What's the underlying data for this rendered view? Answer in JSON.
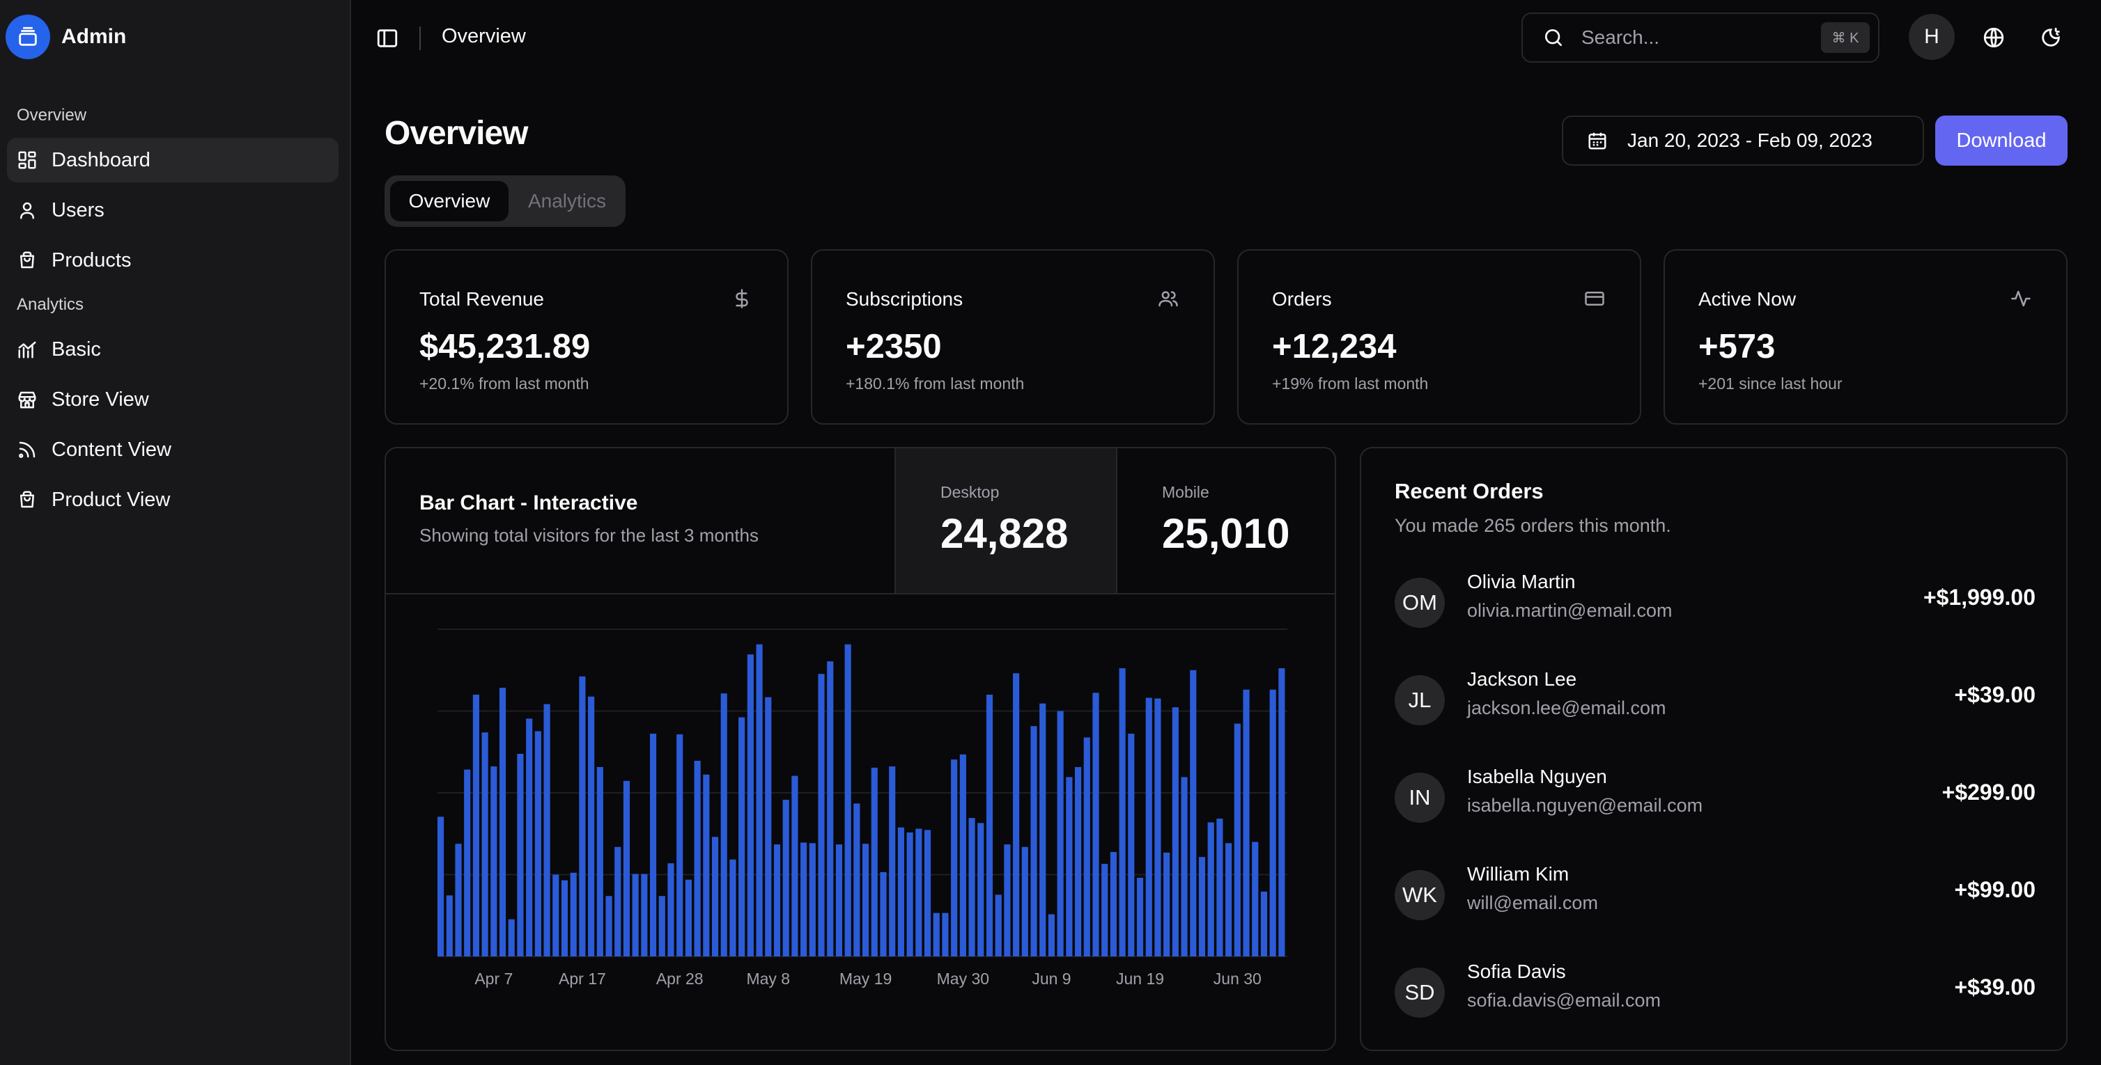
{
  "brand": {
    "name": "Admin"
  },
  "sidebar": {
    "sections": [
      {
        "label": "Overview",
        "items": [
          {
            "label": "Dashboard",
            "icon": "dashboard-icon",
            "active": true
          },
          {
            "label": "Users",
            "icon": "user-icon"
          },
          {
            "label": "Products",
            "icon": "shopping-bag-icon"
          }
        ]
      },
      {
        "label": "Analytics",
        "items": [
          {
            "label": "Basic",
            "icon": "chart-line-icon"
          },
          {
            "label": "Store View",
            "icon": "store-icon"
          },
          {
            "label": "Content View",
            "icon": "rss-icon"
          },
          {
            "label": "Product View",
            "icon": "shopping-bag-icon"
          }
        ]
      }
    ]
  },
  "header": {
    "title": "Overview",
    "search_placeholder": "Search...",
    "search_shortcut": "⌘ K",
    "avatar_initial": "H"
  },
  "main": {
    "title": "Overview",
    "date_range": "Jan 20, 2023 - Feb 09, 2023",
    "download_label": "Download",
    "tabs": [
      {
        "label": "Overview",
        "active": true
      },
      {
        "label": "Analytics"
      }
    ]
  },
  "stats": [
    {
      "label": "Total Revenue",
      "value": "$45,231.89",
      "sub": "+20.1% from last month",
      "icon": "dollar-icon"
    },
    {
      "label": "Subscriptions",
      "value": "+2350",
      "sub": "+180.1% from last month",
      "icon": "users-icon"
    },
    {
      "label": "Orders",
      "value": "+12,234",
      "sub": "+19% from last month",
      "icon": "credit-card-icon"
    },
    {
      "label": "Active Now",
      "value": "+573",
      "sub": "+201 since last hour",
      "icon": "activity-icon"
    }
  ],
  "chart_card": {
    "title": "Bar Chart - Interactive",
    "subtitle": "Showing total visitors for the last 3 months",
    "desktop_label": "Desktop",
    "desktop_total": "24,828",
    "mobile_label": "Mobile",
    "mobile_total": "25,010"
  },
  "chart_data": {
    "type": "bar",
    "active_series": "Desktop",
    "color": "#2b5bd7",
    "x_tick_labels": [
      "Apr 7",
      "Apr 17",
      "Apr 28",
      "May 8",
      "May 19",
      "May 30",
      "Jun 9",
      "Jun 19",
      "Jun 30"
    ],
    "x_tick_index": [
      6,
      16,
      27,
      37,
      48,
      59,
      69,
      79,
      90
    ],
    "ylim": [
      0,
      520
    ],
    "grid": true,
    "values": [
      222,
      97,
      179,
      297,
      416,
      356,
      302,
      427,
      59,
      322,
      378,
      358,
      401,
      130,
      121,
      133,
      445,
      413,
      301,
      96,
      174,
      279,
      131,
      131,
      354,
      96,
      148,
      353,
      122,
      311,
      289,
      190,
      418,
      154,
      380,
      480,
      496,
      412,
      178,
      249,
      287,
      181,
      180,
      449,
      469,
      178,
      496,
      243,
      179,
      300,
      134,
      302,
      205,
      197,
      203,
      201,
      69,
      69,
      313,
      321,
      220,
      212,
      416,
      98,
      178,
      450,
      174,
      366,
      402,
      67,
      390,
      285,
      301,
      348,
      419,
      147,
      166,
      458,
      354,
      125,
      411,
      410,
      165,
      396,
      285,
      455,
      158,
      213,
      219,
      180,
      370,
      424,
      182,
      103,
      424,
      458
    ]
  },
  "orders": {
    "title": "Recent Orders",
    "subtitle": "You made 265 orders this month.",
    "items": [
      {
        "initials": "OM",
        "name": "Olivia Martin",
        "email": "olivia.martin@email.com",
        "amount": "+$1,999.00"
      },
      {
        "initials": "JL",
        "name": "Jackson Lee",
        "email": "jackson.lee@email.com",
        "amount": "+$39.00"
      },
      {
        "initials": "IN",
        "name": "Isabella Nguyen",
        "email": "isabella.nguyen@email.com",
        "amount": "+$299.00"
      },
      {
        "initials": "WK",
        "name": "William Kim",
        "email": "will@email.com",
        "amount": "+$99.00"
      },
      {
        "initials": "SD",
        "name": "Sofia Davis",
        "email": "sofia.davis@email.com",
        "amount": "+$39.00"
      }
    ]
  }
}
